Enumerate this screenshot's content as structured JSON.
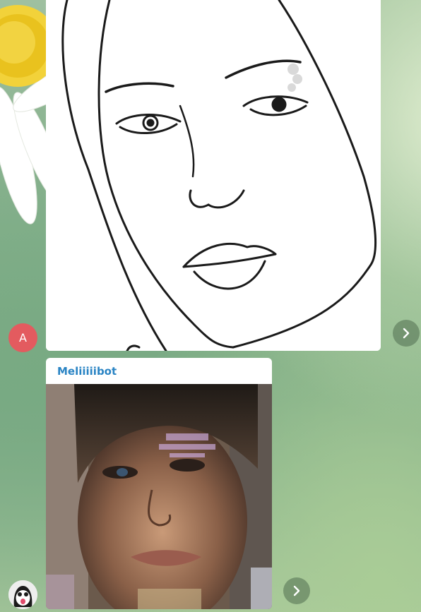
{
  "messages": [
    {
      "type": "photo",
      "sender_avatar": {
        "initial": "A",
        "color": "#e35b5f"
      },
      "image": "line-drawing-face"
    },
    {
      "type": "photo",
      "sender_name": "Meliiiiibot",
      "sender_name_color": "#2a84c4",
      "sender_avatar": {
        "icon": "ghost-avatar-icon"
      },
      "image": "generated-face-photo"
    }
  ],
  "actions": {
    "forward_icon": "chevron-right-icon"
  }
}
